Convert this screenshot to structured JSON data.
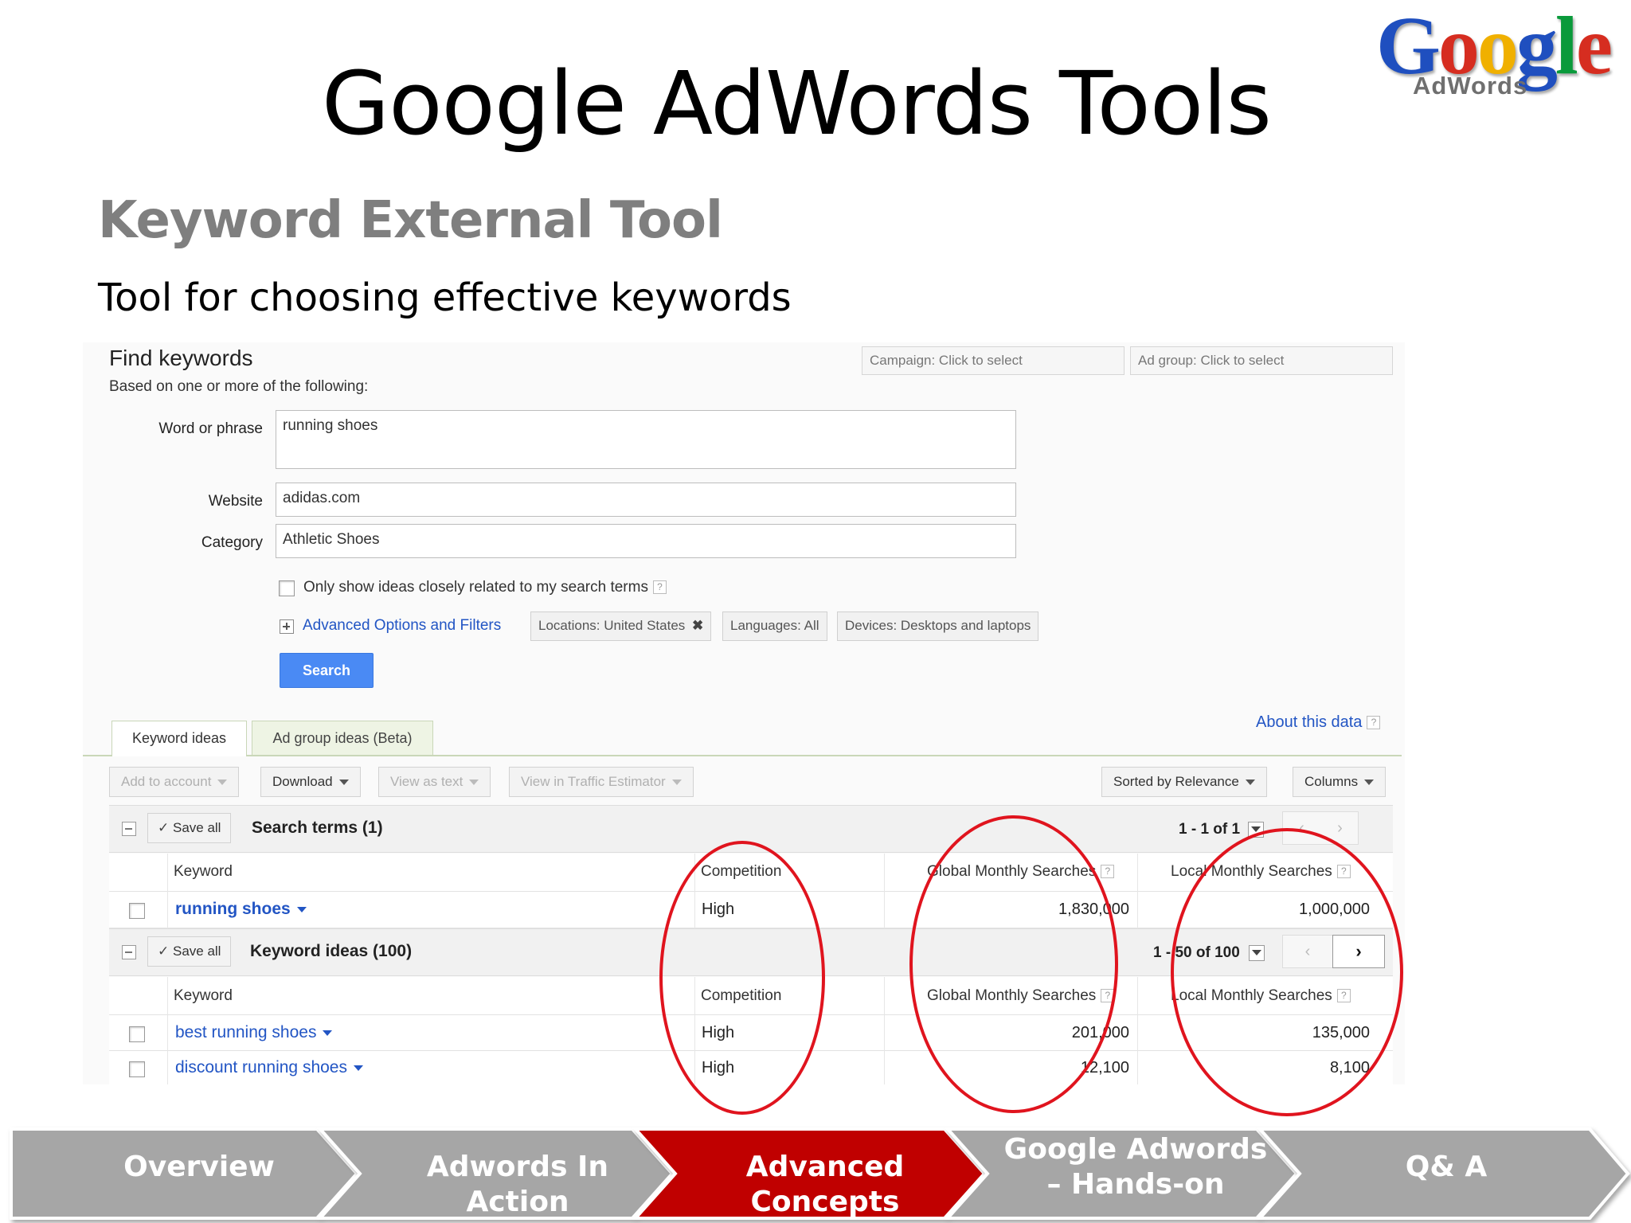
{
  "slide": {
    "title": "Google AdWords Tools",
    "subtitle": "Keyword External Tool",
    "tagline": "Tool for choosing effective keywords"
  },
  "logo": {
    "word": "Google",
    "sub": "AdWords"
  },
  "form": {
    "heading": "Find keywords",
    "subheading": "Based on one or more of the following:",
    "campaign_select": "Campaign: Click to select",
    "adgroup_select": "Ad group: Click to select",
    "word_label": "Word or phrase",
    "word_value": "running shoes",
    "website_label": "Website",
    "website_value": "adidas.com",
    "category_label": "Category",
    "category_value": "Athletic Shoes",
    "only_related_label": "Only show ideas closely related to my search terms",
    "advanced_label": "Advanced Options and Filters",
    "chip_locations": "Locations: United States",
    "chip_languages": "Languages: All",
    "chip_devices": "Devices: Desktops and laptops",
    "search_button": "Search"
  },
  "results": {
    "tab_keyword_ideas": "Keyword ideas",
    "tab_adgroup_ideas": "Ad group ideas (Beta)",
    "about_data": "About this data",
    "toolbar": {
      "add_to_account": "Add to account",
      "download": "Download",
      "view_as_text": "View as text",
      "view_traffic": "View in Traffic Estimator",
      "sorted": "Sorted by Relevance",
      "columns": "Columns"
    },
    "save_all": "Save all",
    "search_terms_group": {
      "title": "Search terms (1)",
      "pager": "1 - 1 of 1",
      "headers": {
        "keyword": "Keyword",
        "competition": "Competition",
        "global": "Global Monthly Searches",
        "local": "Local Monthly Searches"
      },
      "rows": [
        {
          "keyword": "running shoes",
          "competition": "High",
          "global": "1,830,000",
          "local": "1,000,000"
        }
      ]
    },
    "keyword_ideas_group": {
      "title": "Keyword ideas (100)",
      "pager": "1 - 50 of 100",
      "headers": {
        "keyword": "Keyword",
        "competition": "Competition",
        "global": "Global Monthly Searches",
        "local": "Local Monthly Searches"
      },
      "rows": [
        {
          "keyword": "best running shoes",
          "competition": "High",
          "global": "201,000",
          "local": "135,000"
        },
        {
          "keyword": "discount running shoes",
          "competition": "High",
          "global": "12,100",
          "local": "8,100"
        }
      ]
    }
  },
  "nav": {
    "items": [
      "Overview",
      "Adwords In Action",
      "Advanced Concepts",
      "Google Adwords – Hands-on",
      "Q& A"
    ],
    "active_index": 2,
    "active_color": "#c00000",
    "inactive_color": "#a6a6a6"
  }
}
